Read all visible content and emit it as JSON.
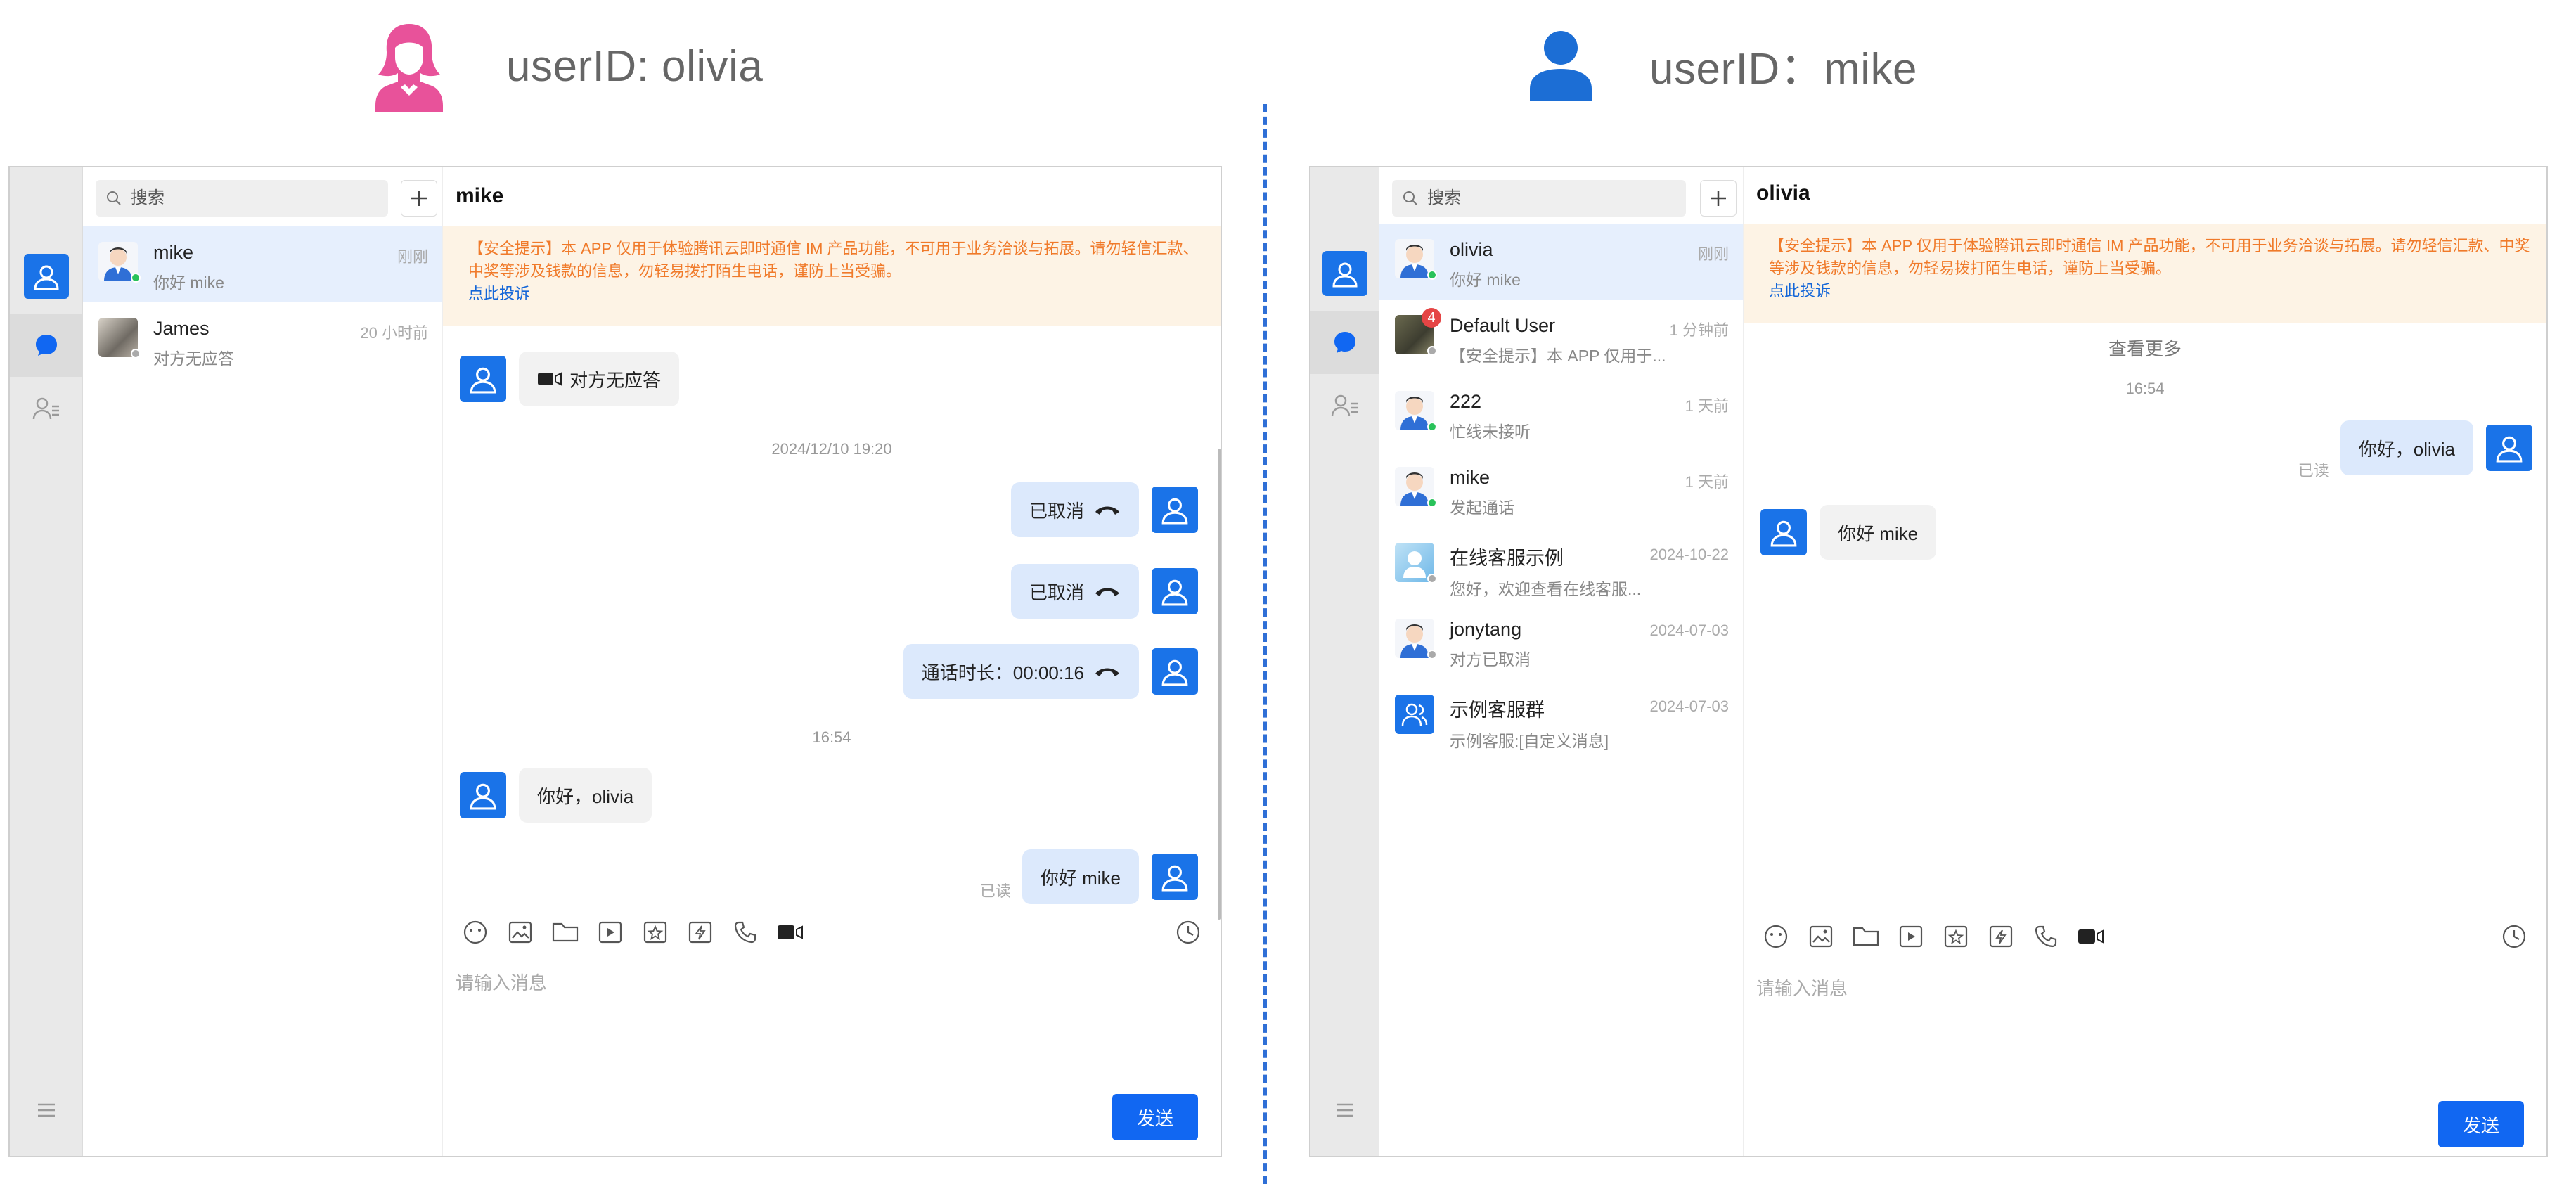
{
  "header": {
    "left_user": "userID: olivia",
    "right_user": "userID：mike"
  },
  "colors": {
    "accent": "#1167f2",
    "avatar_blue": "#1a73e8",
    "female_icon": "#e8529a",
    "male_icon": "#1c6ed5",
    "divider": "#2f6fd6",
    "notice_text": "#f07a2a",
    "notice_bg": "#fdf3e5"
  },
  "left": {
    "search_placeholder": "搜索",
    "conversations": [
      {
        "name": "mike",
        "sub": "你好 mike",
        "time": "刚刚",
        "active": true,
        "status": "online",
        "avatar": "cartoon-man"
      },
      {
        "name": "James",
        "sub": "对方无应答",
        "time": "20 小时前",
        "active": false,
        "status": "offline",
        "avatar": "photo"
      }
    ],
    "chat": {
      "title": "mike",
      "notice": "【安全提示】本 APP 仅用于体验腾讯云即时通信 IM 产品功能，不可用于业务洽谈与拓展。请勿轻信汇款、中奖等涉及钱款的信息，勿轻易拨打陌生电话，谨防上当受骗。",
      "notice_link": "点此投诉",
      "messages": {
        "no_answer": "对方无应答",
        "time_1": "2024/12/10 19:20",
        "cancel_1": "已取消",
        "cancel_2": "已取消",
        "duration": "通话时长：00:00:16",
        "time_2": "16:54",
        "hello_olivia": "你好，olivia",
        "hello_mike": "你好 mike",
        "read": "已读"
      },
      "input_placeholder": "请输入消息",
      "send": "发送"
    }
  },
  "right": {
    "search_placeholder": "搜索",
    "conversations": [
      {
        "name": "olivia",
        "sub": "你好 mike",
        "time": "刚刚",
        "active": true,
        "status": "online",
        "avatar": "cartoon-man"
      },
      {
        "name": "Default User",
        "sub": "【安全提示】本 APP 仅用于...",
        "time": "1 分钟前",
        "active": false,
        "status": "offline",
        "avatar": "photo",
        "badge": "4"
      },
      {
        "name": "222",
        "sub": "忙线未接听",
        "time": "1 天前",
        "active": false,
        "status": "online",
        "avatar": "cartoon-man"
      },
      {
        "name": "mike",
        "sub": "发起通话",
        "time": "1 天前",
        "active": false,
        "status": "online",
        "avatar": "cartoon-man"
      },
      {
        "name": "在线客服示例",
        "sub": "您好，欢迎查看在线客服...",
        "time": "2024-10-22",
        "active": false,
        "status": "offline",
        "avatar": "service"
      },
      {
        "name": "jonytang",
        "sub": "对方已取消",
        "time": "2024-07-03",
        "active": false,
        "status": "offline",
        "avatar": "cartoon-man"
      },
      {
        "name": "示例客服群",
        "sub": "示例客服:[自定义消息]",
        "time": "2024-07-03",
        "active": false,
        "status": "none",
        "avatar": "group"
      }
    ],
    "chat": {
      "title": "olivia",
      "notice": "【安全提示】本 APP 仅用于体验腾讯云即时通信 IM 产品功能，不可用于业务洽谈与拓展。请勿轻信汇款、中奖等涉及钱款的信息，勿轻易拨打陌生电话，谨防上当受骗。",
      "notice_link": "点此投诉",
      "more": "查看更多",
      "messages": {
        "time_1": "16:54",
        "hello_olivia": "你好，olivia",
        "read": "已读",
        "hello_mike": "你好 mike"
      },
      "input_placeholder": "请输入消息",
      "send": "发送"
    }
  }
}
